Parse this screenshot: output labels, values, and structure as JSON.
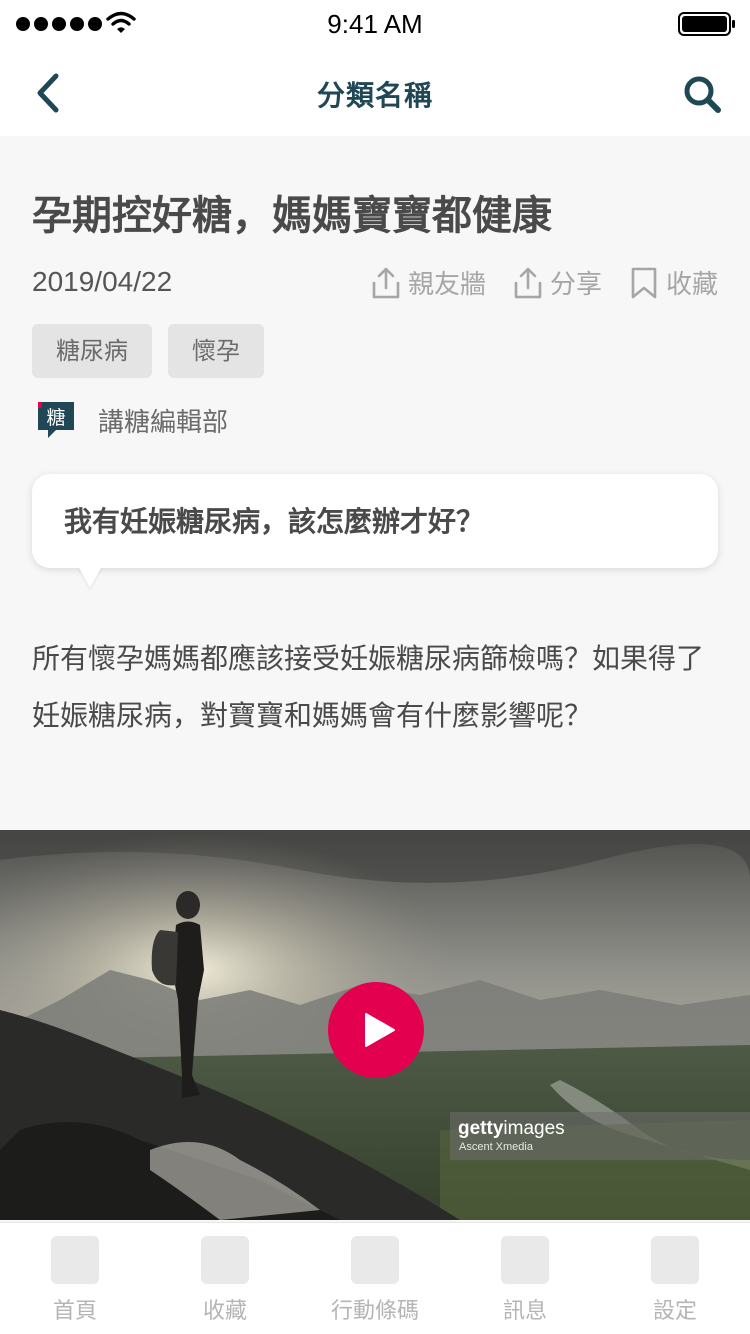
{
  "status_bar": {
    "time": "9:41 AM"
  },
  "nav": {
    "title": "分類名稱"
  },
  "article": {
    "title": "孕期控好糖，媽媽寶寶都健康",
    "date": "2019/04/22",
    "actions": {
      "share_friends": "親友牆",
      "share": "分享",
      "bookmark": "收藏"
    },
    "tags": [
      "糖尿病",
      "懷孕"
    ],
    "author": "講糖編輯部",
    "author_logo_char": "糖",
    "question": "我有妊娠糖尿病，該怎麼辦才好？",
    "intro": "所有懷孕媽媽都應該接受妊娠糖尿病篩檢嗎？如果得了妊娠糖尿病，對寶寶和媽媽會有什麼影響呢？"
  },
  "video": {
    "watermark_brand_bold": "getty",
    "watermark_brand_light": "images",
    "watermark_credit": "Ascent Xmedia",
    "play_color": "#e3004f"
  },
  "tabs": [
    {
      "label": "首頁"
    },
    {
      "label": "收藏"
    },
    {
      "label": "行動條碼"
    },
    {
      "label": "訊息"
    },
    {
      "label": "設定"
    }
  ],
  "colors": {
    "nav_accent": "#1f4756",
    "tab_label": "#b5b5b5",
    "tag_bg": "#e4e4e4"
  }
}
